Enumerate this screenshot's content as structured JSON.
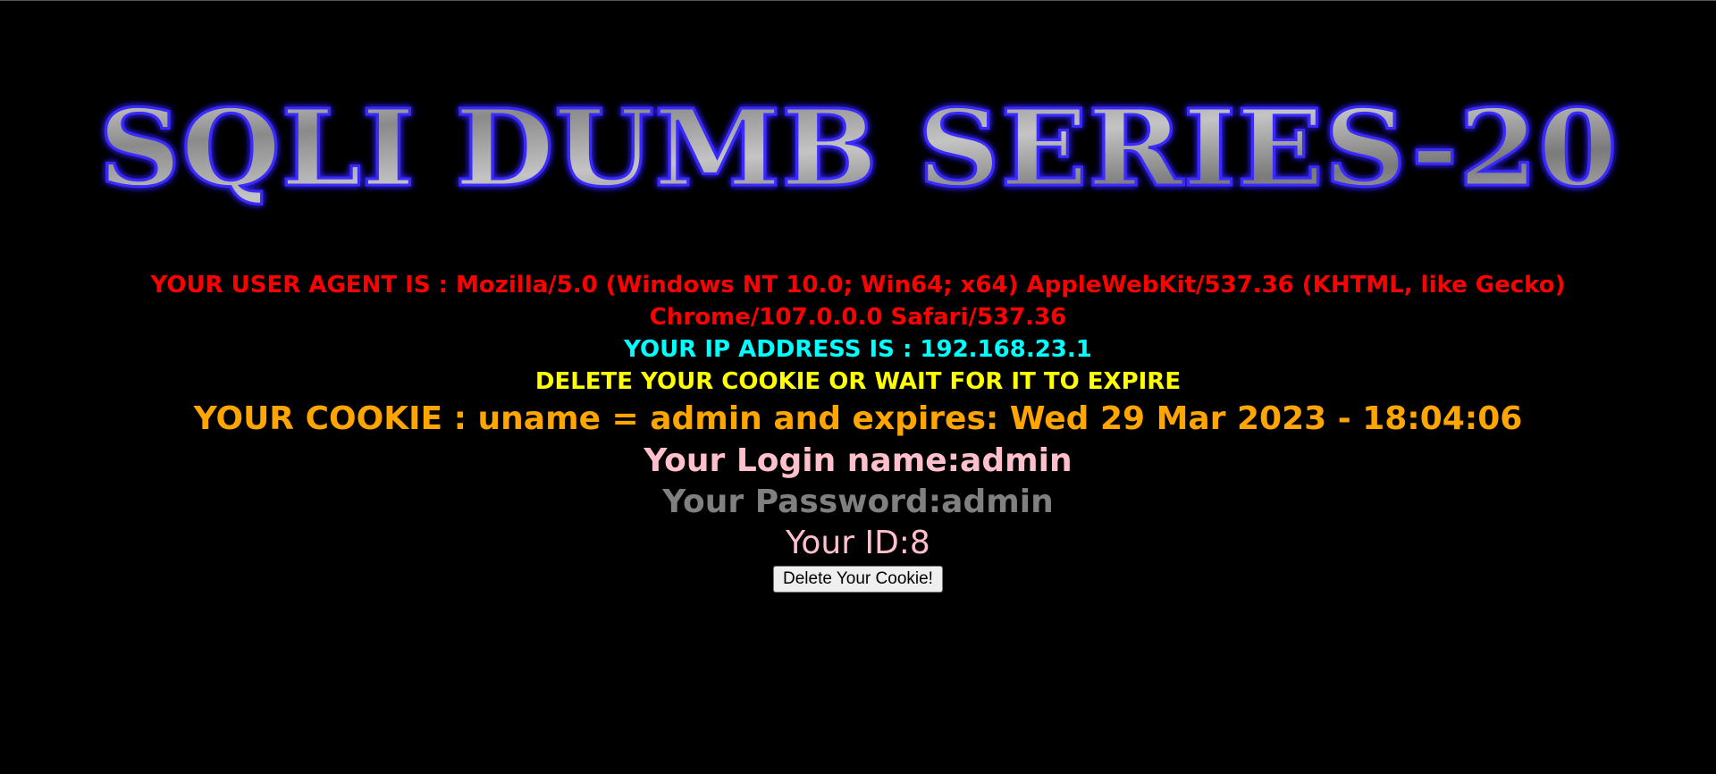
{
  "page": {
    "title": "SQLI DUMB SERIES-20"
  },
  "info": {
    "user_agent": "YOUR USER AGENT IS : Mozilla/5.0 (Windows NT 10.0; Win64; x64) AppleWebKit/537.36 (KHTML, like Gecko) Chrome/107.0.0.0 Safari/537.36",
    "ip_address": "YOUR IP ADDRESS IS : 192.168.23.1",
    "delete_message": "DELETE YOUR COOKIE OR WAIT FOR IT TO EXPIRE",
    "cookie": "YOUR COOKIE : uname = admin and expires: Wed 29 Mar 2023 - 18:04:06",
    "login_name": "Your Login name:admin",
    "password": "Your Password:admin",
    "id": "Your ID:8"
  },
  "form": {
    "delete_button_label": "Delete Your Cookie!"
  },
  "colors": {
    "background": "#000000",
    "user_agent": "#ff0000",
    "ip": "#00ffff",
    "delete_message": "#ffff00",
    "cookie": "#ffa500",
    "login": "#ffc0cb",
    "password": "#808080",
    "title_glow": "#2b1fd6"
  }
}
